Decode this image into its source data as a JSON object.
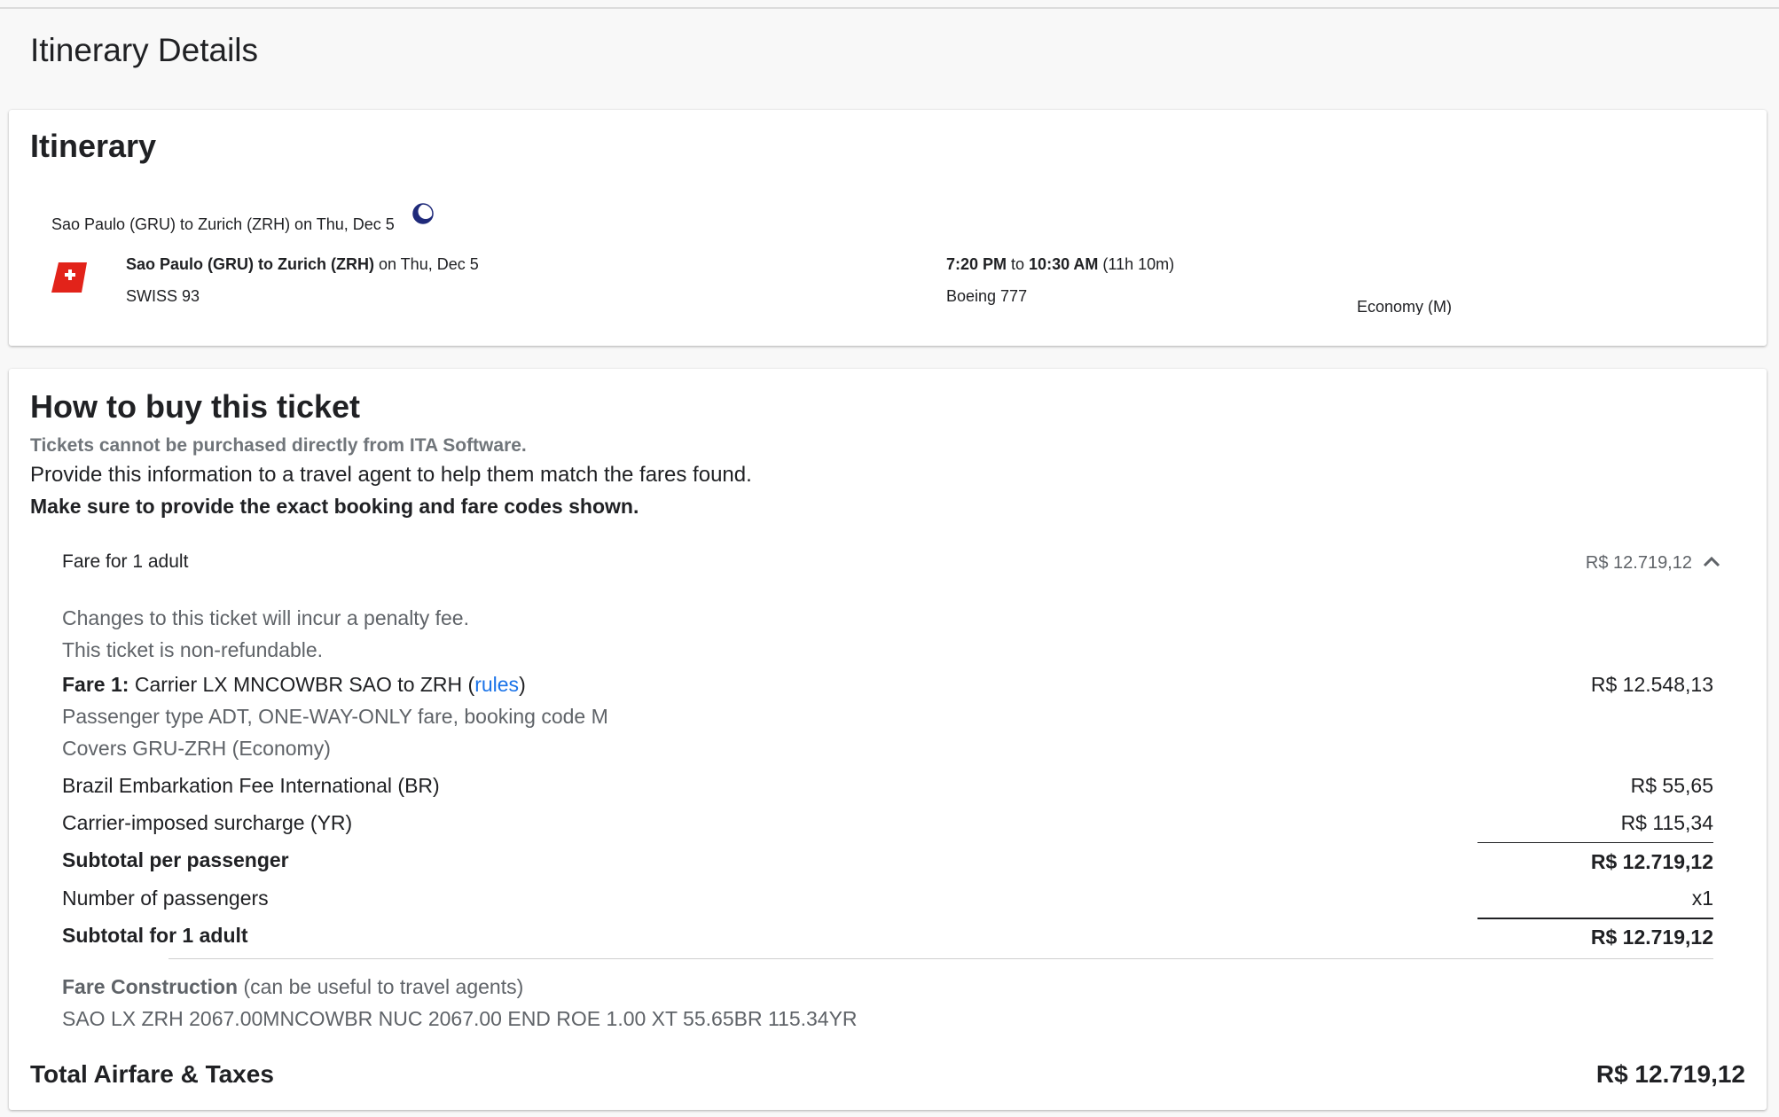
{
  "page": {
    "title": "Itinerary Details"
  },
  "itinerary": {
    "heading": "Itinerary",
    "segment_title": "Sao Paulo (GRU) to Zurich (ZRH) on Thu, Dec 5",
    "route_bold": "Sao Paulo (GRU) to Zurich (ZRH)",
    "route_date": " on Thu, Dec 5",
    "flight": "SWISS 93",
    "depart": "7:20 PM",
    "to": " to ",
    "arrive": "10:30 AM",
    "duration": " (11h 10m)",
    "aircraft": "Boeing 777",
    "cabin": "Economy (M)",
    "icons": {
      "overnight": "moon-icon",
      "airline": "swiss-airline-logo"
    }
  },
  "buy": {
    "heading": "How to buy this ticket",
    "note": "Tickets cannot be purchased directly from ITA Software.",
    "info": "Provide this information to a travel agent to help them match the fares found.",
    "warning": "Make sure to provide the exact booking and fare codes shown.",
    "fare_header": {
      "label": "Fare for 1 adult",
      "amount": "R$ 12.719,12"
    },
    "penalty": "Changes to this ticket will incur a penalty fee.",
    "refund": "This ticket is non-refundable.",
    "fare1": {
      "label": "Fare 1:",
      "desc_pre": " Carrier LX MNCOWBR SAO to ZRH (",
      "link": "rules",
      "desc_post": ")",
      "amount": "R$ 12.548,13",
      "pax_line": "Passenger type ADT, ONE-WAY-ONLY fare, booking code M",
      "covers": "Covers GRU-ZRH (Economy)"
    },
    "fees": [
      {
        "label": "Brazil Embarkation Fee International (BR)",
        "amount": "R$ 55,65"
      },
      {
        "label": "Carrier-imposed surcharge (YR)",
        "amount": "R$ 115,34"
      }
    ],
    "subtotal_per_pax": {
      "label": "Subtotal per passenger",
      "amount": "R$ 12.719,12"
    },
    "num_pax": {
      "label": "Number of passengers",
      "amount": "x1"
    },
    "subtotal_adult": {
      "label": "Subtotal for 1 adult",
      "amount": "R$ 12.719,12"
    },
    "fare_construction": {
      "label": "Fare Construction",
      "hint": " (can be useful to travel agents)",
      "code": "SAO LX ZRH 2067.00MNCOWBR NUC 2067.00 END ROE 1.00 XT 55.65BR 115.34YR"
    },
    "total": {
      "label": "Total Airfare & Taxes",
      "amount": "R$ 12.719,12"
    }
  }
}
